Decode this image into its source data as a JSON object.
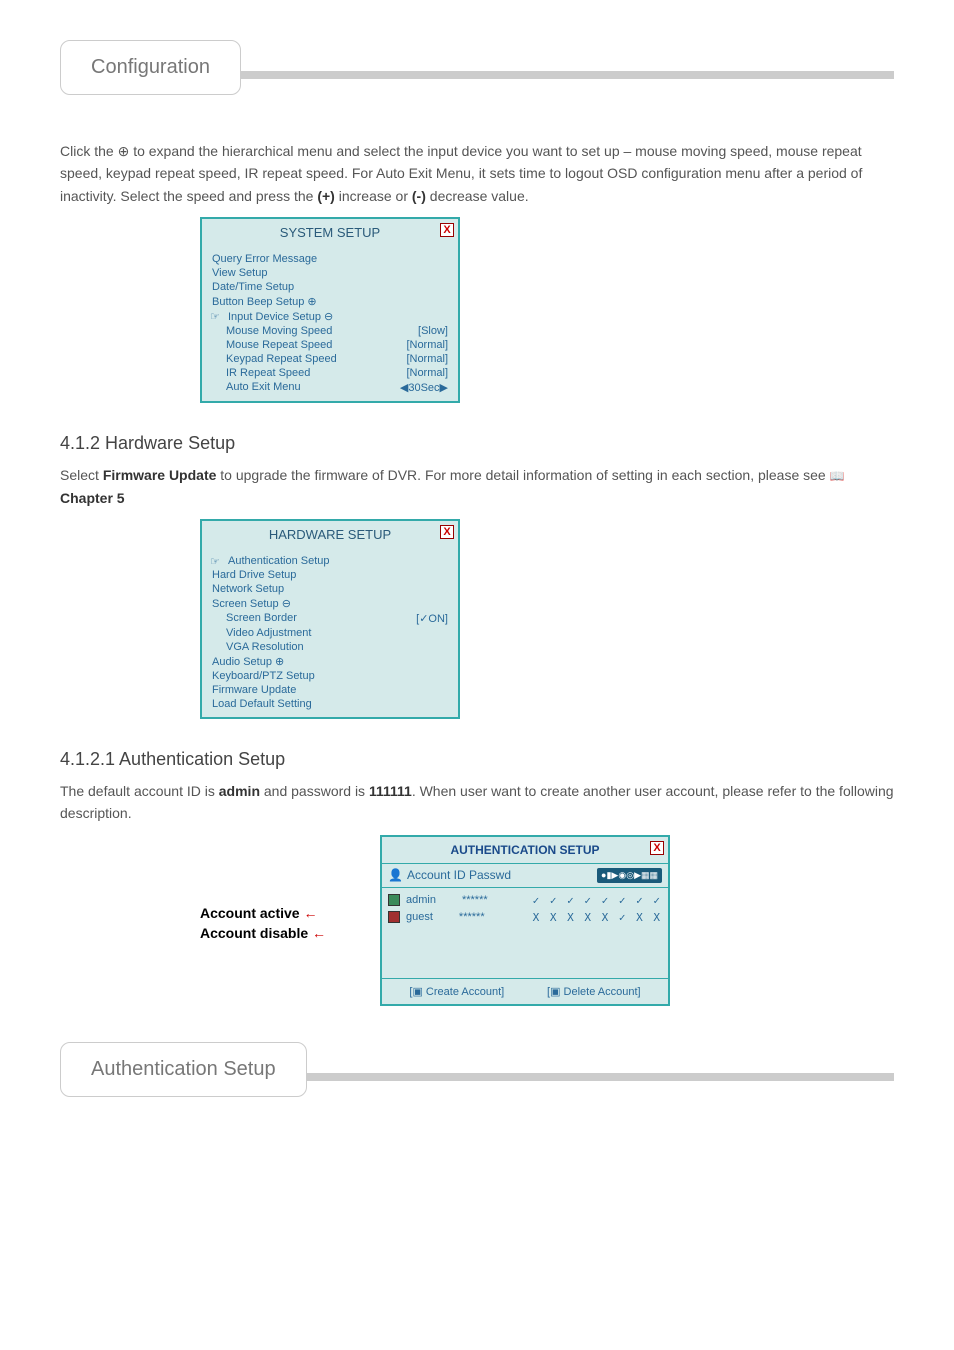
{
  "tabs": {
    "config": "Configuration",
    "auth": "Authentication Setup"
  },
  "intro": {
    "prefix": "Click the",
    "icon_desc": "icon",
    "rest": " to expand the hierarchical menu and select the input device you want to set up – mouse moving speed, mouse repeat speed, keypad repeat speed, IR repeat speed. For Auto Exit Menu, it sets time to logout OSD configuration menu after a period of inactivity. Select the speed and press the ",
    "bold1": "(+)",
    "rest2": " increase or ",
    "bold2": "(-)",
    "rest3": " decrease value."
  },
  "panel1": {
    "title": "SYSTEM SETUP",
    "items": [
      "Query Error Message",
      "View Setup",
      "Date/Time Setup",
      "Button Beep Setup ⊕"
    ],
    "selected": "Input Device Setup ⊖",
    "sub": [
      {
        "l": "Mouse Moving Speed",
        "v": "[Slow]"
      },
      {
        "l": "Mouse Repeat Speed",
        "v": "[Normal]"
      },
      {
        "l": "Keypad Repeat Speed",
        "v": "[Normal]"
      },
      {
        "l": "IR Repeat Speed",
        "v": "[Normal]"
      },
      {
        "l": "Auto Exit Menu",
        "v": "◀30Sec▶"
      }
    ]
  },
  "s412": {
    "head": "4.1.2 Hardware Setup",
    "para_a": "Select ",
    "bold": "Firmware Update",
    "para_b": " to upgrade the firmware of DVR. For more detail information of setting in each section, please see ",
    "chap": "Chapter 5"
  },
  "panel2": {
    "title": "HARDWARE SETUP",
    "selected": "Authentication Setup",
    "items": [
      "Hard Drive Setup",
      "Network Setup"
    ],
    "screen": "Screen Setup ⊖",
    "sub": [
      {
        "l": "Screen Border",
        "v": "[✓ON]"
      },
      {
        "l": "Video Adjustment",
        "v": ""
      },
      {
        "l": "VGA Resolution",
        "v": ""
      }
    ],
    "rest": [
      "Audio Setup ⊕",
      "Keyboard/PTZ Setup",
      "Firmware Update",
      "Load Default Setting"
    ]
  },
  "s4121": {
    "head": "4.1.2.1 Authentication Setup",
    "para": "The default account ID is ",
    "admin": "admin",
    "para2": " and password is ",
    "pw": "111111",
    "para3": ". When user want to create another user account, please refer to the following description."
  },
  "auth": {
    "title": "AUTHENTICATION SETUP",
    "hdr_acc": "Account ID Passwd",
    "rows": [
      {
        "id": "admin",
        "pw": "******",
        "perms": "✓ ✓ ✓ ✓ ✓ ✓ ✓ ✓",
        "active": true
      },
      {
        "id": "guest",
        "pw": "******",
        "perms": "X X X X X ✓ X X",
        "active": false
      }
    ],
    "create": "Create Account]",
    "delete": "Delete Account]"
  },
  "labels": {
    "active": "Account active",
    "disable": "Account disable"
  }
}
